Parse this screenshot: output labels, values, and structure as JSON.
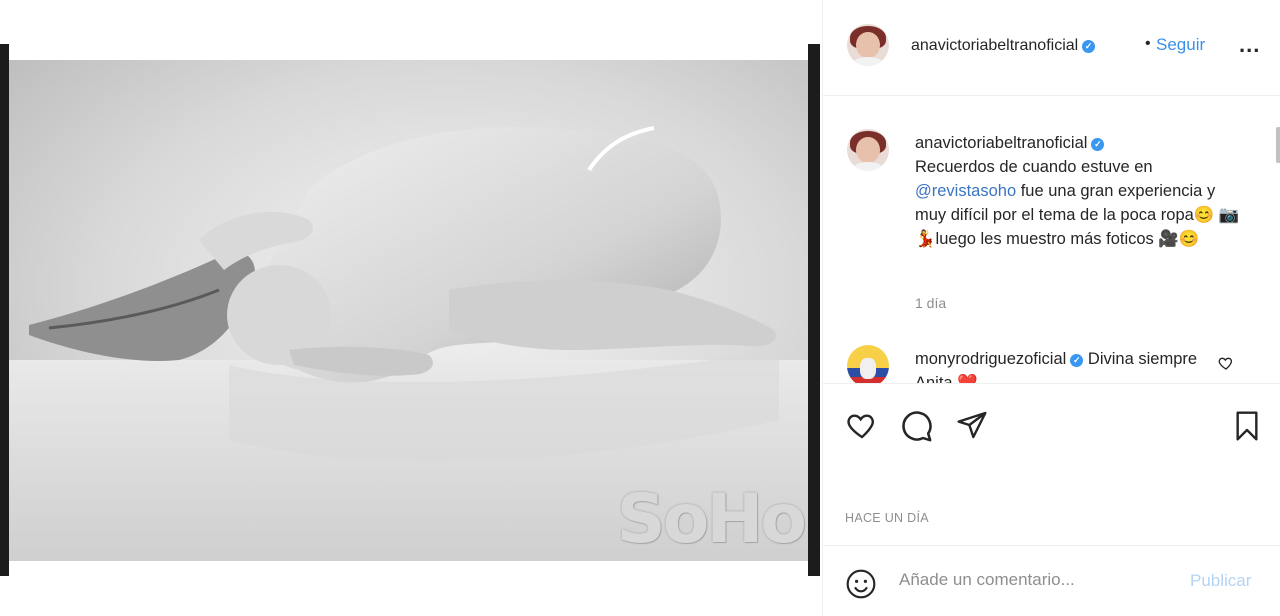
{
  "media": {
    "watermark": "SoHo",
    "photo_style": "black-and-white"
  },
  "header": {
    "username": "anavictoriabeltranoficial",
    "verified": true,
    "separator": "•",
    "follow_label": "Seguir",
    "more_label": "..."
  },
  "caption": {
    "username": "anavictoriabeltranoficial",
    "text_before_mention": "Recuerdos de cuando estuve en ",
    "mention": "@revistasoho",
    "text_after_mention": " fue una gran experiencia y muy difícil por el tema de la poca ropa😊 📷💃luego les muestro más foticos 🎥😊",
    "time": "1 día"
  },
  "comment": {
    "username": "monyrodriguezoficial",
    "text": "Divina siempre Anita ❤️"
  },
  "actions": {
    "like_icon": "heart-icon",
    "comment_icon": "comment-bubble-icon",
    "share_icon": "paper-plane-icon",
    "save_icon": "bookmark-icon"
  },
  "post_time": "HACE UN DÍA",
  "composer": {
    "placeholder": "Añade un comentario...",
    "publish_label": "Publicar"
  },
  "colors": {
    "link_blue": "#3a90e8",
    "publish_disabled": "#b3d4f6",
    "muted": "#8e8e8e"
  }
}
